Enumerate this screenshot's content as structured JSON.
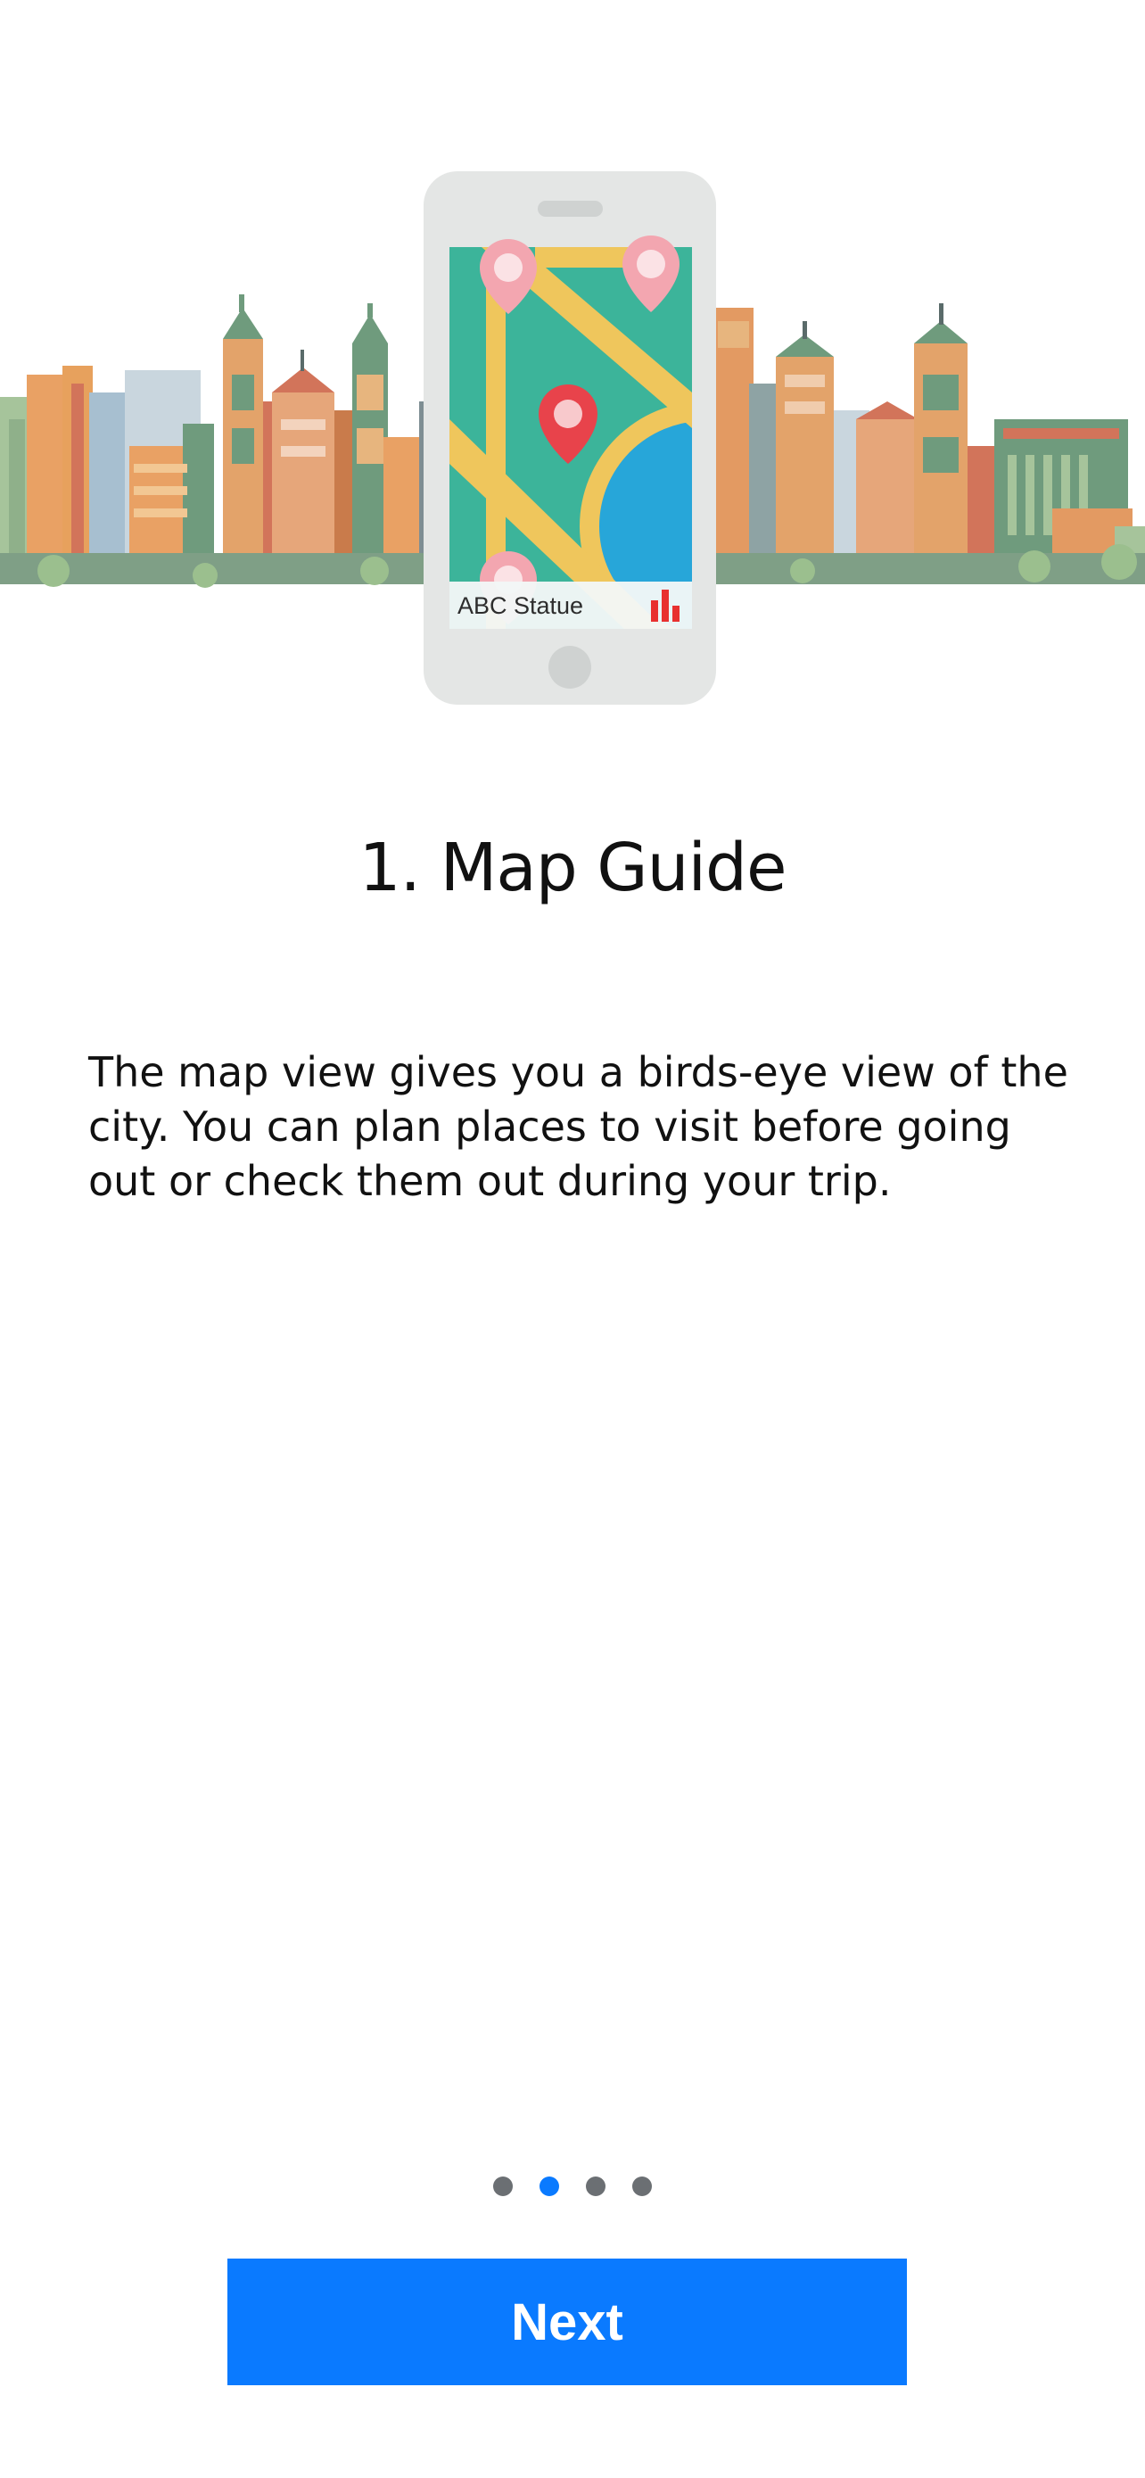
{
  "hero": {
    "map_label": "ABC Statue",
    "phone_icon": "bar-chart-icon"
  },
  "page": {
    "title": "1. Map Guide",
    "description": "The map view gives you a birds-eye view of the city. You can plan places to visit before going out or check them out during your trip."
  },
  "pager": {
    "dot_count": 4,
    "active_index": 1
  },
  "actions": {
    "next_label": "Next"
  },
  "colors": {
    "accent": "#0a7aff",
    "dot_inactive": "#6b6f73",
    "map_green": "#3cb49a",
    "map_road": "#efc65c",
    "map_water": "#27a6d9",
    "pin_red": "#e8434b",
    "pin_pink": "#f3a6b0"
  }
}
